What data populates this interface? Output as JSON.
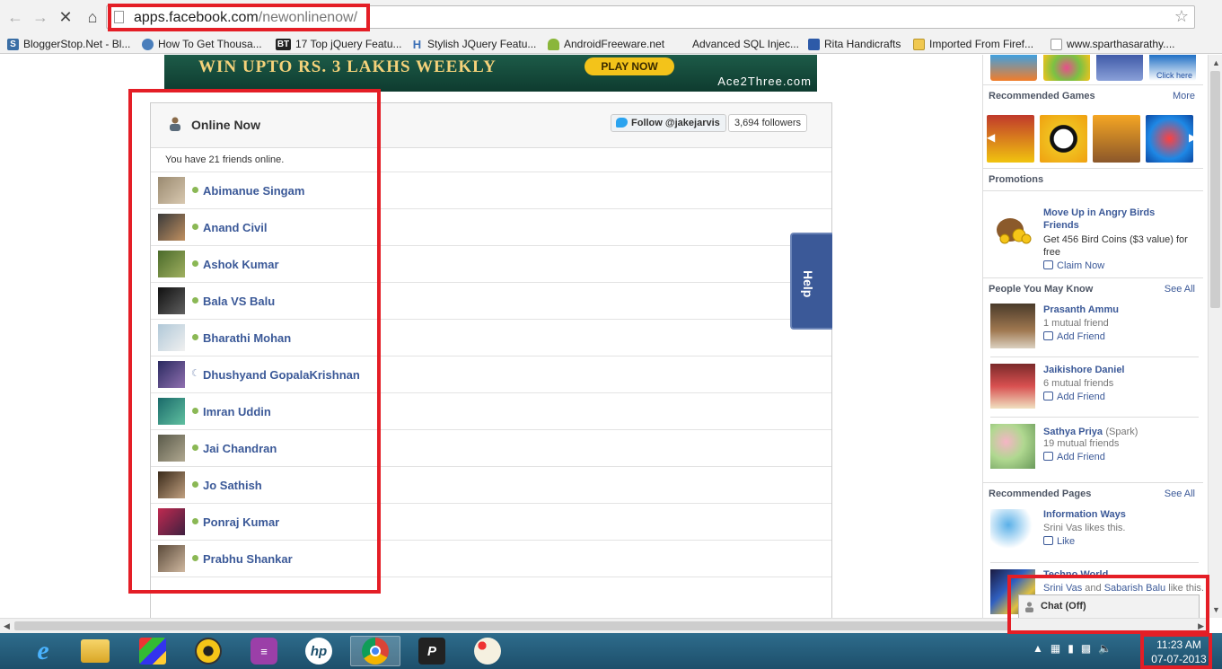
{
  "browser": {
    "url_host": "apps.facebook.com",
    "url_path": "/newonlinenow/",
    "bookmarks": [
      "BloggerStop.Net - Bl...",
      "How To Get Thousa...",
      "17 Top jQuery Featu...",
      "Stylish JQuery Featu...",
      "AndroidFreeware.net",
      "Advanced SQL Injec...",
      "Rita Handicrafts",
      "Imported From Firef...",
      "www.sparthasarathy...."
    ]
  },
  "banner": {
    "headline": "WIN UPTO RS. 3 LAKHS WEEKLY",
    "button": "PLAY NOW",
    "brand": "Ace2Three.com"
  },
  "app": {
    "title": "Online Now",
    "follow_label": "Follow @jakejarvis",
    "followers_label": "3,694 followers",
    "summary": "You have 21 friends online.",
    "help_label": "Help",
    "friends": [
      {
        "name": "Abimanue Singam",
        "status": "online"
      },
      {
        "name": "Anand Civil",
        "status": "online"
      },
      {
        "name": "Ashok Kumar",
        "status": "online"
      },
      {
        "name": "Bala VS Balu",
        "status": "online"
      },
      {
        "name": "Bharathi Mohan",
        "status": "online"
      },
      {
        "name": "Dhushyand GopalaKrishnan",
        "status": "idle"
      },
      {
        "name": "Imran Uddin",
        "status": "online"
      },
      {
        "name": "Jai Chandran",
        "status": "online"
      },
      {
        "name": "Jo Sathish",
        "status": "online"
      },
      {
        "name": "Ponraj Kumar",
        "status": "online"
      },
      {
        "name": "Prabhu Shankar",
        "status": "online"
      }
    ]
  },
  "sidebar": {
    "top_tile_text": "Click here",
    "recommended_games": {
      "title": "Recommended Games",
      "more": "More"
    },
    "promotions": {
      "title": "Promotions",
      "link": "Move Up in Angry Birds Friends",
      "text": "Get 456 Bird Coins ($3 value) for free",
      "action": "Claim Now"
    },
    "people": {
      "title": "People You May Know",
      "see_all": "See All",
      "items": [
        {
          "name": "Prasanth Ammu",
          "extra": "",
          "mutual": "1 mutual friend",
          "action": "Add Friend"
        },
        {
          "name": "Jaikishore Daniel",
          "extra": "",
          "mutual": "6 mutual friends",
          "action": "Add Friend"
        },
        {
          "name": "Sathya Priya",
          "extra": "(Spark)",
          "mutual": "19 mutual friends",
          "action": "Add Friend"
        }
      ]
    },
    "pages": {
      "title": "Recommended Pages",
      "see_all": "See All",
      "items": [
        {
          "name": "Information Ways",
          "likes": "Srini Vas likes this.",
          "action": "Like"
        },
        {
          "name": "Techno World",
          "likes_a": "Srini Vas",
          "likes_join": "and",
          "likes_b": "Sabarish Balu",
          "likes_end": "like this."
        }
      ]
    },
    "chat_label": "Chat (Off)"
  },
  "taskbar": {
    "time": "11:23 AM",
    "date": "07-07-2013"
  },
  "colors": {
    "facebook_blue": "#3b5998",
    "highlight_red": "#e41e26",
    "online_green": "#8bb855"
  }
}
